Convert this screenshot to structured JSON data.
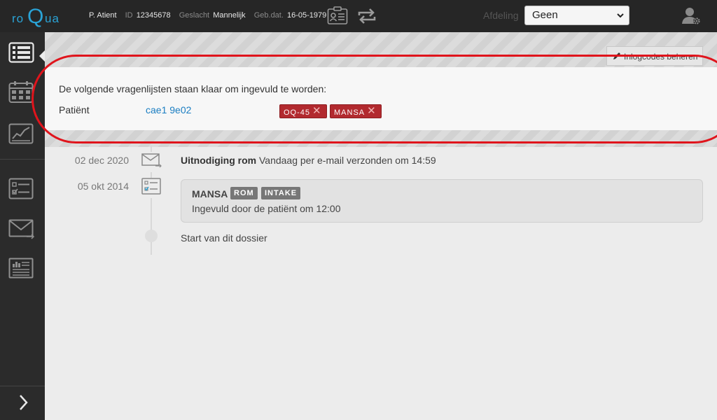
{
  "app": {
    "logo_ro": "ro",
    "logo_q": "Q",
    "logo_ua": "ua"
  },
  "patient": {
    "name": "P. Atient",
    "id_label": "ID",
    "id_value": "12345678",
    "gender_label": "Geslacht",
    "gender_value": "Mannelijk",
    "dob_label": "Geb.dat.",
    "dob_value": "16-05-1979"
  },
  "header": {
    "afdeling_label": "Afdeling",
    "afdeling_selected": "Geen"
  },
  "sidebar": {
    "items": [
      {
        "icon": "dossier-list-icon",
        "active": true
      },
      {
        "icon": "calendar-icon"
      },
      {
        "icon": "chart-icon"
      },
      {
        "icon": "questionnaire-icon"
      },
      {
        "icon": "envelope-icon"
      },
      {
        "icon": "report-icon"
      }
    ],
    "expand_icon": "chevron-right-icon"
  },
  "inlog": {
    "label": "Inlogcodes beheren"
  },
  "panel": {
    "message": "De volgende vragenlijsten staan klaar om ingevuld te worden:",
    "patient_label": "Patiënt",
    "patient_link": "cae1 9e02",
    "tags": [
      "OQ-45",
      "MANSA"
    ],
    "tag_remove": "✕"
  },
  "timeline": {
    "entries": [
      {
        "date": "02 dec 2020",
        "icon": "envelope-icon",
        "title": "Uitnodiging rom",
        "text": " Vandaag per e-mail verzonden om 14:59"
      },
      {
        "date": "05 okt 2014",
        "icon": "questionnaire-icon",
        "title": "MANSA",
        "badges": [
          "ROM",
          "INTAKE"
        ],
        "text": "Ingevuld door de patiënt om 12:00"
      }
    ],
    "start": "Start van dit dossier"
  },
  "colors": {
    "accent": "#2aa3d6",
    "topbar": "#262626",
    "sidebar": "#2b2b2b",
    "tag_red": "#b22a2f",
    "highlight": "#e0141c",
    "link": "#1b7ec2"
  }
}
